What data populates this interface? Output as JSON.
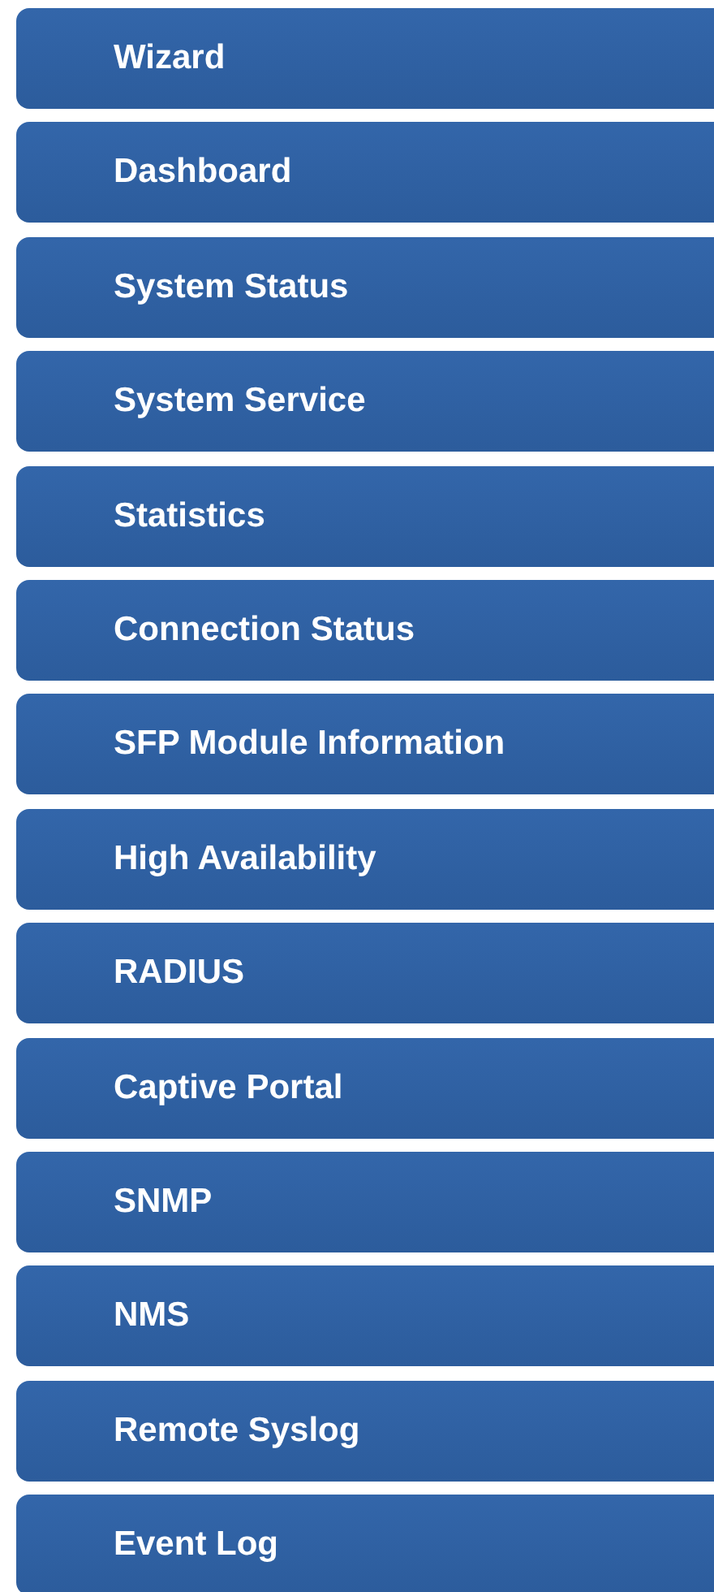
{
  "menu": {
    "items": [
      {
        "label": "Wizard"
      },
      {
        "label": "Dashboard"
      },
      {
        "label": "System Status"
      },
      {
        "label": "System Service"
      },
      {
        "label": "Statistics"
      },
      {
        "label": "Connection Status"
      },
      {
        "label": "SFP Module Information"
      },
      {
        "label": "High Availability"
      },
      {
        "label": "RADIUS"
      },
      {
        "label": "Captive Portal"
      },
      {
        "label": "SNMP"
      },
      {
        "label": "NMS"
      },
      {
        "label": "Remote Syslog"
      },
      {
        "label": "Event Log"
      }
    ]
  }
}
